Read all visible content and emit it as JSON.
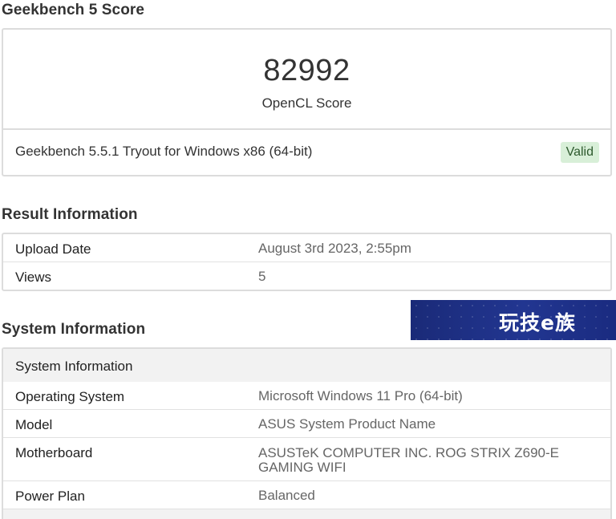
{
  "geekbench_score": {
    "section_title": "Geekbench 5 Score",
    "score": "82992",
    "score_label": "OpenCL Score",
    "version": "Geekbench 5.5.1 Tryout for Windows x86 (64-bit)",
    "status_badge": "Valid"
  },
  "result_information": {
    "section_title": "Result Information",
    "rows": [
      {
        "key": "Upload Date",
        "value": "August 3rd 2023, 2:55pm"
      },
      {
        "key": "Views",
        "value": "5"
      }
    ]
  },
  "system_information": {
    "section_title": "System Information",
    "table_header": "System Information",
    "rows": [
      {
        "key": "Operating System",
        "value": "Microsoft Windows 11 Pro (64-bit)"
      },
      {
        "key": "Model",
        "value": "ASUS System Product Name"
      },
      {
        "key": "Motherboard",
        "value": "ASUSTeK COMPUTER INC. ROG STRIX Z690-E GAMING WIFI"
      },
      {
        "key": "Power Plan",
        "value": "Balanced"
      }
    ]
  },
  "watermark": {
    "text": "玩技e族"
  },
  "colors": {
    "valid_badge_bg": "#d8efd8",
    "valid_badge_text": "#2e5a2e",
    "border": "#dcdcdc",
    "header_bg": "#f2f2f2",
    "watermark_bg": "#223691"
  }
}
